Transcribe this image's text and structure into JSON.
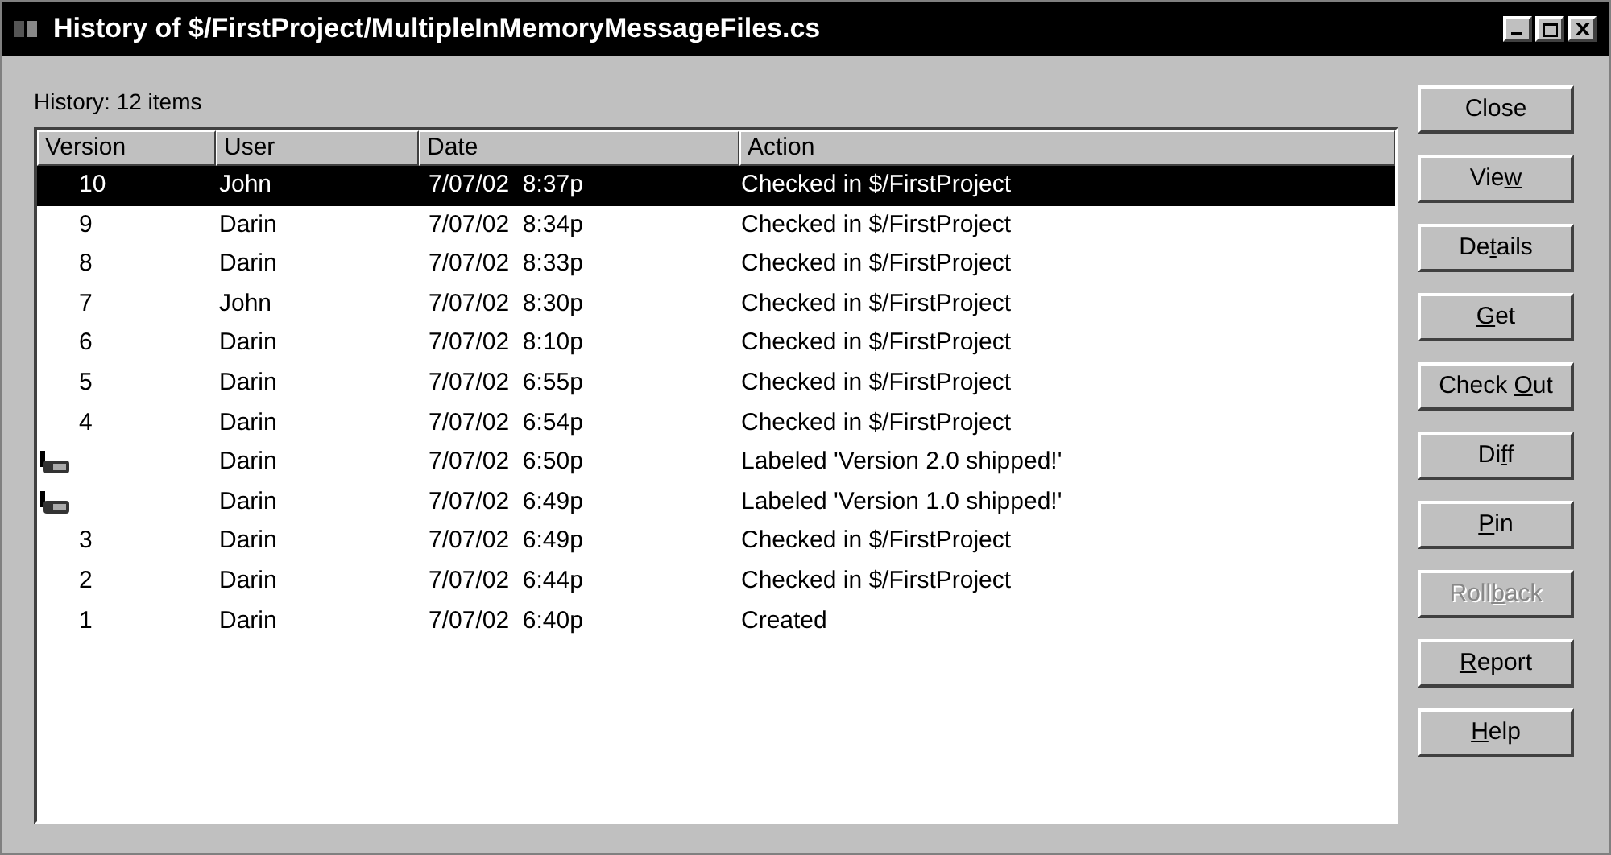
{
  "window": {
    "title": "History of $/FirstProject/MultipleInMemoryMessageFiles.cs",
    "controls": [
      {
        "kind": "minimize"
      },
      {
        "kind": "maximize"
      },
      {
        "kind": "close"
      }
    ]
  },
  "summary": "History: 12 items",
  "table": {
    "columns": [
      "Version",
      "User",
      "Date",
      "Action"
    ],
    "rows": [
      {
        "kind": "version",
        "version": "10",
        "user": "John",
        "date": "7/07/02  8:37p",
        "action": "Checked in $/FirstProject",
        "selected": true
      },
      {
        "kind": "version",
        "version": "9",
        "user": "Darin",
        "date": "7/07/02  8:34p",
        "action": "Checked in $/FirstProject",
        "selected": false
      },
      {
        "kind": "version",
        "version": "8",
        "user": "Darin",
        "date": "7/07/02  8:33p",
        "action": "Checked in $/FirstProject",
        "selected": false
      },
      {
        "kind": "version",
        "version": "7",
        "user": "John",
        "date": "7/07/02  8:30p",
        "action": "Checked in $/FirstProject",
        "selected": false
      },
      {
        "kind": "version",
        "version": "6",
        "user": "Darin",
        "date": "7/07/02  8:10p",
        "action": "Checked in $/FirstProject",
        "selected": false
      },
      {
        "kind": "version",
        "version": "5",
        "user": "Darin",
        "date": "7/07/02  6:55p",
        "action": "Checked in $/FirstProject",
        "selected": false
      },
      {
        "kind": "version",
        "version": "4",
        "user": "Darin",
        "date": "7/07/02  6:54p",
        "action": "Checked in $/FirstProject",
        "selected": false
      },
      {
        "kind": "label",
        "user": "Darin",
        "date": "7/07/02  6:50p",
        "action": "Labeled 'Version 2.0 shipped!'",
        "selected": false
      },
      {
        "kind": "label",
        "user": "Darin",
        "date": "7/07/02  6:49p",
        "action": "Labeled 'Version 1.0 shipped!'",
        "selected": false
      },
      {
        "kind": "version",
        "version": "3",
        "user": "Darin",
        "date": "7/07/02  6:49p",
        "action": "Checked in $/FirstProject",
        "selected": false
      },
      {
        "kind": "version",
        "version": "2",
        "user": "Darin",
        "date": "7/07/02  6:44p",
        "action": "Checked in $/FirstProject",
        "selected": false
      },
      {
        "kind": "version",
        "version": "1",
        "user": "Darin",
        "date": "7/07/02  6:40p",
        "action": "Created",
        "selected": false
      }
    ]
  },
  "buttons": [
    {
      "before": "Close",
      "disabled": false
    },
    {
      "before": "Vie",
      "access_key": "w",
      "disabled": false
    },
    {
      "before": "De",
      "access_key": "t",
      "after": "ails",
      "disabled": false
    },
    {
      "access_key": "G",
      "after": "et",
      "disabled": false
    },
    {
      "before": "Check ",
      "access_key": "O",
      "after": "ut",
      "disabled": false
    },
    {
      "before": "Di",
      "access_key": "f",
      "after": "f",
      "disabled": false
    },
    {
      "access_key": "P",
      "after": "in",
      "disabled": false
    },
    {
      "before": "Roll",
      "access_key": "b",
      "after": "ack",
      "disabled": true
    },
    {
      "access_key": "R",
      "after": "eport",
      "disabled": false
    },
    {
      "access_key": "H",
      "after": "elp",
      "disabled": false
    }
  ]
}
